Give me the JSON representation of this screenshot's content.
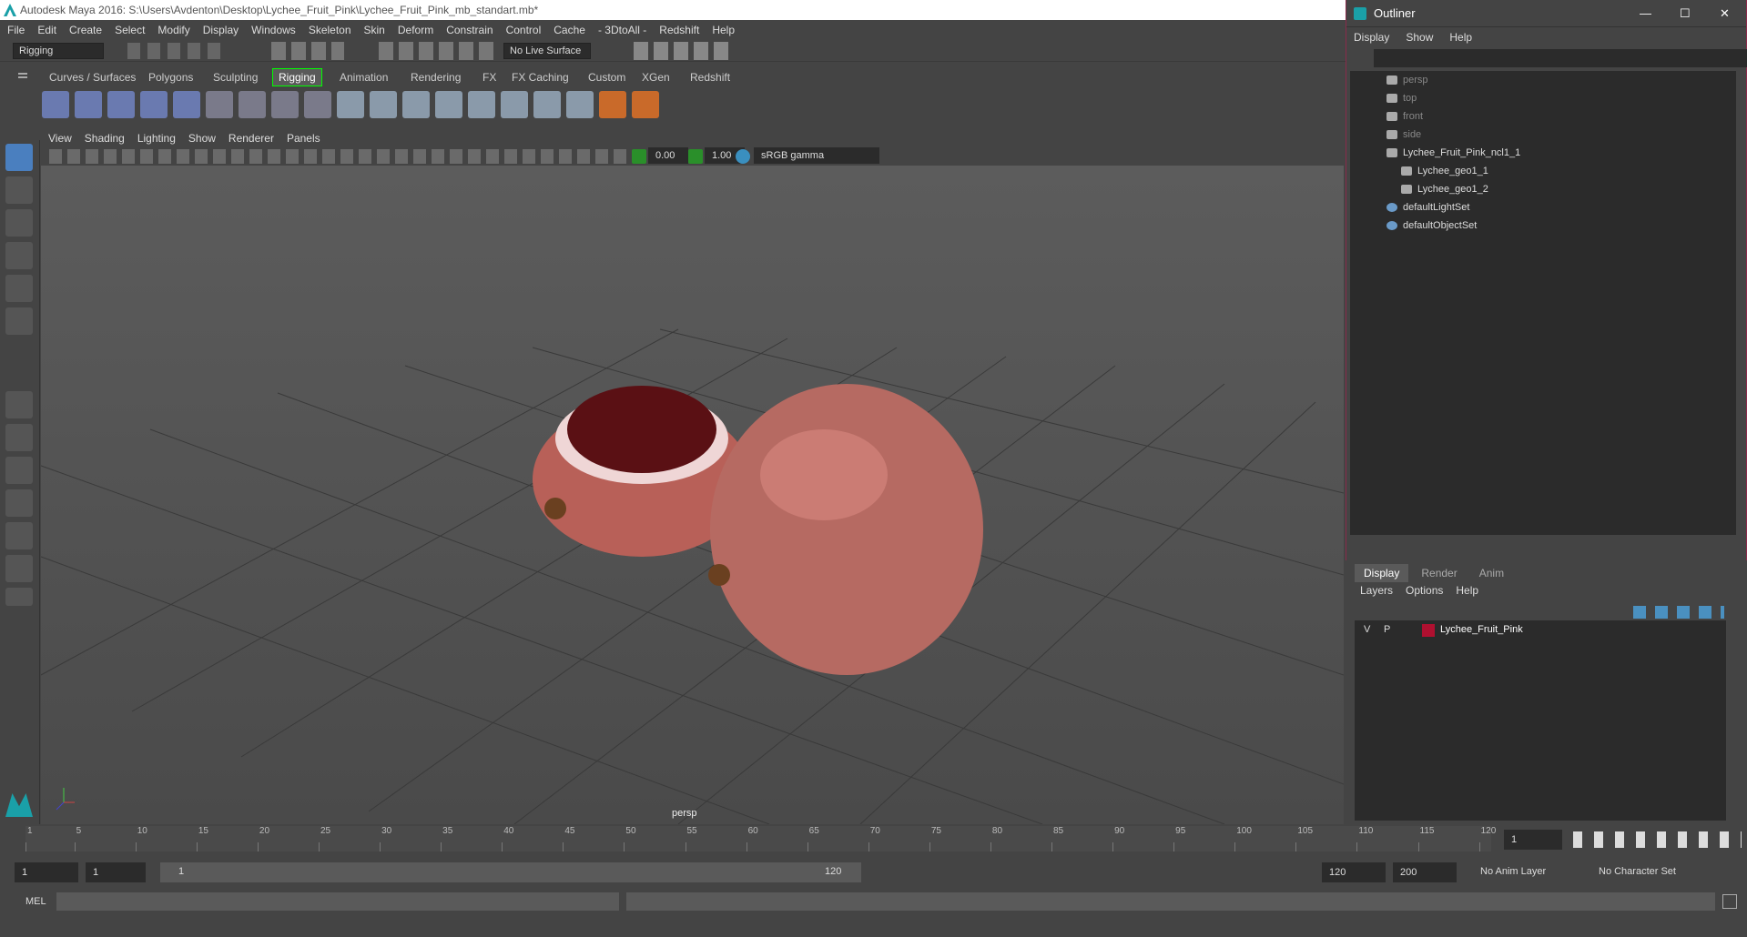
{
  "window": {
    "title": "Autodesk Maya 2016: S:\\Users\\Avdenton\\Desktop\\Lychee_Fruit_Pink\\Lychee_Fruit_Pink_mb_standart.mb*"
  },
  "menubar": [
    "File",
    "Edit",
    "Create",
    "Select",
    "Modify",
    "Display",
    "Windows",
    "Skeleton",
    "Skin",
    "Deform",
    "Constrain",
    "Control",
    "Cache",
    "- 3DtoAll -",
    "Redshift",
    "Help"
  ],
  "statusline": {
    "mode": "Rigging",
    "live_surface": "No Live Surface"
  },
  "shelf_tabs": [
    "Curves / Surfaces",
    "Polygons",
    "Sculpting",
    "Rigging",
    "Animation",
    "Rendering",
    "FX",
    "FX Caching",
    "Custom",
    "XGen",
    "Redshift"
  ],
  "active_shelf": "Rigging",
  "panel_menu": [
    "View",
    "Shading",
    "Lighting",
    "Show",
    "Renderer",
    "Panels"
  ],
  "panel_toolbar": {
    "exposure": "0.00",
    "gamma": "1.00",
    "color_space": "sRGB gamma"
  },
  "viewport": {
    "camera": "persp"
  },
  "outliner": {
    "title": "Outliner",
    "menu": [
      "Display",
      "Show",
      "Help"
    ],
    "items": [
      {
        "label": "persp",
        "dim": true
      },
      {
        "label": "top",
        "dim": true
      },
      {
        "label": "front",
        "dim": true
      },
      {
        "label": "side",
        "dim": true
      },
      {
        "label": "Lychee_Fruit_Pink_ncl1_1",
        "dim": false
      },
      {
        "label": "Lychee_geo1_1",
        "dim": false
      },
      {
        "label": "Lychee_geo1_2",
        "dim": false
      },
      {
        "label": "defaultLightSet",
        "dim": false
      },
      {
        "label": "defaultObjectSet",
        "dim": false
      }
    ]
  },
  "layer_editor": {
    "tabs": [
      "Display",
      "Render",
      "Anim"
    ],
    "menu": [
      "Layers",
      "Options",
      "Help"
    ],
    "layer": {
      "v": "V",
      "p": "P",
      "name": "Lychee_Fruit_Pink",
      "color": "#b01030"
    }
  },
  "timeline": {
    "ticks": [
      "1",
      "5",
      "10",
      "15",
      "20",
      "25",
      "30",
      "35",
      "40",
      "45",
      "50",
      "55",
      "60",
      "65",
      "70",
      "75",
      "80",
      "85",
      "90",
      "95",
      "100",
      "105",
      "110",
      "115",
      "120"
    ],
    "current_frame": "1"
  },
  "range": {
    "start": "1",
    "anim_start": "1",
    "slider_start": "1",
    "slider_end": "120",
    "end": "120",
    "anim_end": "200",
    "anim_layer": "No Anim Layer",
    "char_set": "No Character Set"
  },
  "cmd": {
    "label": "MEL"
  }
}
